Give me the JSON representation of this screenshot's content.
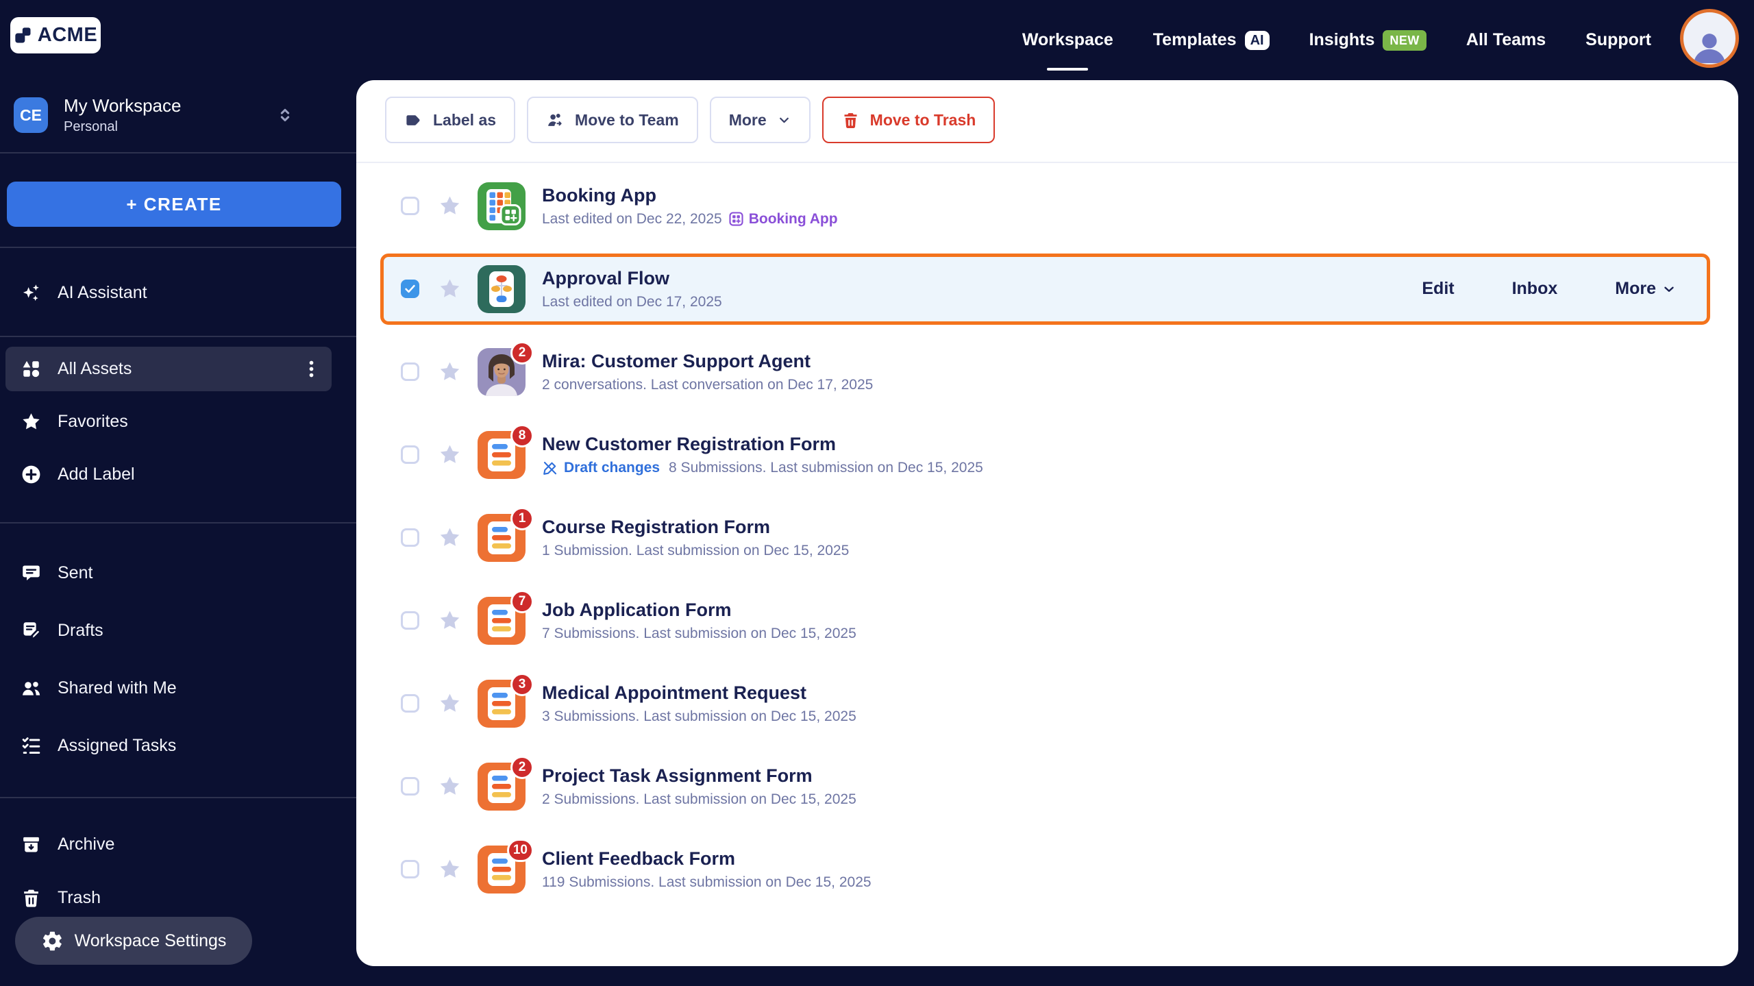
{
  "brand": {
    "name": "ACME"
  },
  "nav": {
    "items": [
      {
        "label": "Workspace",
        "active": true
      },
      {
        "label": "Templates",
        "badge": "AI",
        "badge_type": "ai"
      },
      {
        "label": "Insights",
        "badge": "NEW",
        "badge_type": "new"
      },
      {
        "label": "All Teams"
      },
      {
        "label": "Support"
      }
    ]
  },
  "sidebar": {
    "workspace_switcher": {
      "avatar_initials": "CE",
      "title": "My Workspace",
      "subtitle": "Personal"
    },
    "create_button": "+ CREATE",
    "groups": [
      {
        "items": [
          {
            "label": "AI Assistant",
            "icon": "sparkles-icon"
          }
        ]
      },
      {
        "items": [
          {
            "label": "All Assets",
            "icon": "assets-icon",
            "active": true,
            "has_menu": true
          },
          {
            "label": "Favorites",
            "icon": "star-icon"
          },
          {
            "label": "Add Label",
            "icon": "plus-circle-icon"
          }
        ]
      },
      {
        "items": [
          {
            "label": "Sent",
            "icon": "sent-icon"
          },
          {
            "label": "Drafts",
            "icon": "drafts-icon"
          },
          {
            "label": "Shared with Me",
            "icon": "shared-icon"
          },
          {
            "label": "Assigned Tasks",
            "icon": "tasks-icon"
          }
        ]
      },
      {
        "items": [
          {
            "label": "Archive",
            "icon": "archive-icon"
          },
          {
            "label": "Trash",
            "icon": "trash-icon"
          }
        ]
      }
    ],
    "settings_button": "Workspace Settings"
  },
  "toolbar": {
    "buttons": [
      {
        "label": "Label as",
        "icon": "label-icon"
      },
      {
        "label": "Move to Team",
        "icon": "team-icon"
      },
      {
        "label": "More",
        "has_chevron": true
      },
      {
        "label": "Move to Trash",
        "icon": "trash-red-icon",
        "danger": true
      }
    ]
  },
  "list": {
    "rows": [
      {
        "type": "app",
        "title": "Booking App",
        "subtitle": "Last edited on Dec 22, 2025",
        "linked_asset": "Booking App",
        "checked": false
      },
      {
        "type": "workflow",
        "title": "Approval Flow",
        "subtitle": "Last edited on Dec 17, 2025",
        "checked": true,
        "selected": true,
        "actions": [
          "Edit",
          "Inbox",
          "More"
        ]
      },
      {
        "type": "agent",
        "title": "Mira: Customer Support Agent",
        "subtitle": "2 conversations. Last conversation on Dec 17, 2025",
        "badge": "2"
      },
      {
        "type": "form",
        "title": "New Customer Registration Form",
        "draft_label": "Draft changes",
        "subtitle": "8 Submissions. Last submission on Dec 15, 2025",
        "badge": "8"
      },
      {
        "type": "form",
        "title": "Course Registration Form",
        "subtitle": "1 Submission. Last submission on Dec 15, 2025",
        "badge": "1"
      },
      {
        "type": "form",
        "title": "Job Application Form",
        "subtitle": "7 Submissions. Last submission on Dec 15, 2025",
        "badge": "7"
      },
      {
        "type": "form",
        "title": "Medical Appointment Request",
        "subtitle": "3 Submissions. Last submission on Dec 15, 2025",
        "badge": "3"
      },
      {
        "type": "form",
        "title": "Project Task Assignment Form",
        "subtitle": "2 Submissions. Last submission on Dec 15, 2025",
        "badge": "2"
      },
      {
        "type": "form",
        "title": "Client Feedback Form",
        "subtitle": "119 Submissions. Last submission on Dec 15, 2025",
        "badge": "10"
      }
    ]
  },
  "colors": {
    "background_navy": "#0b1031",
    "panel_white": "#ffffff",
    "accent_orange": "#f4731c",
    "primary_blue": "#3572e3",
    "checkbox_blue": "#3d95e8",
    "danger_red": "#d93a2b",
    "badge_red": "#ce2b2b",
    "link_purple": "#8a4fd8",
    "draft_blue": "#2f6fdb",
    "new_badge_green": "#7ab648",
    "title_navy": "#1a2151",
    "subtitle_gray": "#6e75a3",
    "form_icon_orange": "#ed7133",
    "app_icon_green": "#43a047",
    "workflow_icon_teal": "#2e6b5c"
  }
}
